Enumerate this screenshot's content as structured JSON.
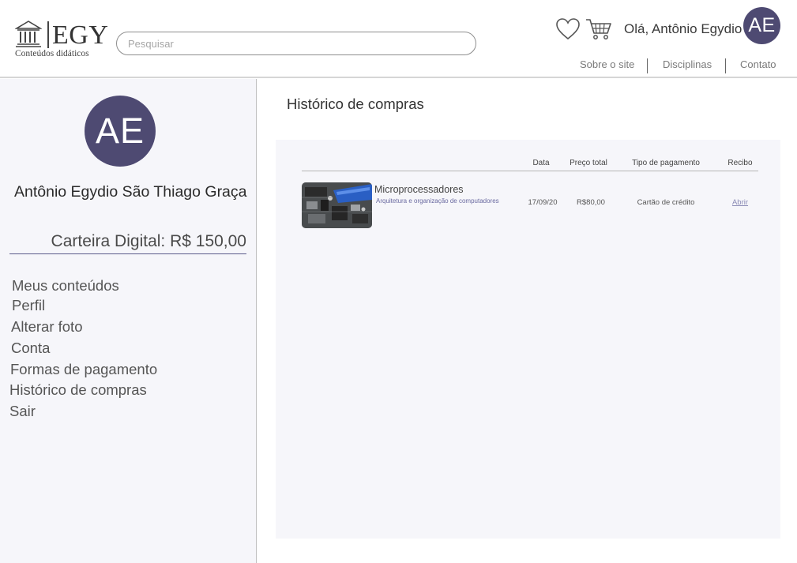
{
  "header": {
    "logo": {
      "brand": "EGY",
      "subtitle": "Conteúdos didáticos",
      "icon": "museum-building-icon"
    },
    "search": {
      "placeholder": "Pesquisar",
      "value": ""
    },
    "icons": {
      "favorites": "heart-icon",
      "cart": "cart-icon"
    },
    "greeting": "Olá, Antônio Egydio",
    "avatar_initials": "AE",
    "nav": [
      "Sobre o site",
      "Disciplinas",
      "Contato"
    ]
  },
  "sidebar": {
    "avatar_initials": "AE",
    "full_name": "Antônio Egydio São Thiago Graça",
    "wallet": "Carteira Digital: R$ 150,00",
    "menu": [
      "Meus conteúdos",
      "Perfil",
      "Alterar foto",
      "Conta",
      "Formas de pagamento",
      "Histórico de compras",
      "Sair"
    ]
  },
  "main": {
    "title": "Histórico de compras",
    "table": {
      "columns": [
        "Data",
        "Preço total",
        "Tipo de pagamento",
        "Recibo"
      ],
      "rows": [
        {
          "title": "Microprocessadores",
          "subtitle": "Arquitetura e organização de computadores",
          "date": "17/09/20",
          "total": "R$80,00",
          "payment": "Cartão de crédito",
          "receipt": "Abrir"
        }
      ]
    }
  },
  "colors": {
    "avatar": "#4e4a72",
    "sidebar_bg": "#f6f6fa",
    "panel_bg": "#f6f6fa",
    "link": "#8a8ab5"
  }
}
